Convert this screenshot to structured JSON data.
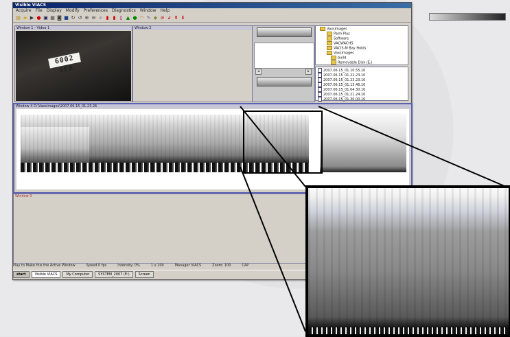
{
  "app": {
    "title": "Visible VIACS",
    "menus": [
      "Acquire",
      "File",
      "Display",
      "Modify",
      "Preferences",
      "Diagnostics",
      "Window",
      "Help"
    ]
  },
  "windows": {
    "window1_title": "Window 1 - Video 1",
    "window2_title": "Window 2",
    "window3_title": "Window 3",
    "scan_title": "Window 4 D:\\Vaxsimages\\2007.06.15_01.23.26"
  },
  "video": {
    "plate_text": "6002 GFA"
  },
  "tree": {
    "folders": [
      "Vaxsimages",
      "Palm Plus",
      "Software",
      "VACWACHS",
      "VACIS-M Bay Holds",
      "Vaxsimages",
      "build",
      "Removable Disk (E:)"
    ],
    "files": [
      "2007.06.15_01.10.55.10",
      "2007.06.15_01.22.23.10",
      "2007.06.15_01.23.23.10",
      "2007.06.15_01.13.46.10",
      "2007.06.15_01.04.30.10",
      "2007.06.15_01.21.24.10",
      "2007.06.15_01.30.00.10"
    ]
  },
  "status": {
    "left": "Play to Make this the Active Window",
    "items": [
      "Speed 0 fps",
      "Intensity: 0%",
      "1 x 100",
      "Manager VIACS",
      "Zoom: 100",
      "CAP"
    ]
  },
  "taskbar": [
    "start",
    "Visible VIACS",
    "My Computer",
    "SYSTEM_2007 (E:)",
    "Screen"
  ],
  "colors": {
    "title_bar": "#0a246a",
    "window_bg": "#d4d0c8",
    "inset_border": "#000000"
  }
}
